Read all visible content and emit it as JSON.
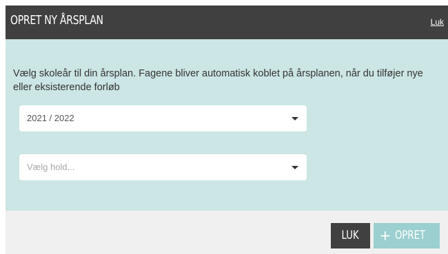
{
  "dialog": {
    "title": "OPRET NY ÅRSPLAN",
    "close_link": "Luk",
    "description": "Vælg skoleår til din årsplan. Fagene bliver automatisk koblet på årsplanen, når du tilføjer nye eller eksisterende forløb",
    "year_select": {
      "value": "2021 / 2022",
      "icon": "chevron-down-icon"
    },
    "team_select": {
      "placeholder": "Vælg hold...",
      "icon": "chevron-down-icon"
    },
    "buttons": {
      "close_label": "LUK",
      "create_icon": "+",
      "create_label": "OPRET"
    }
  },
  "colors": {
    "header_bg": "#404040",
    "body_bg": "#cbe6e4",
    "footer_bg": "#f0f0f0",
    "primary_button": "#9ccfcf",
    "secondary_button": "#404040"
  }
}
